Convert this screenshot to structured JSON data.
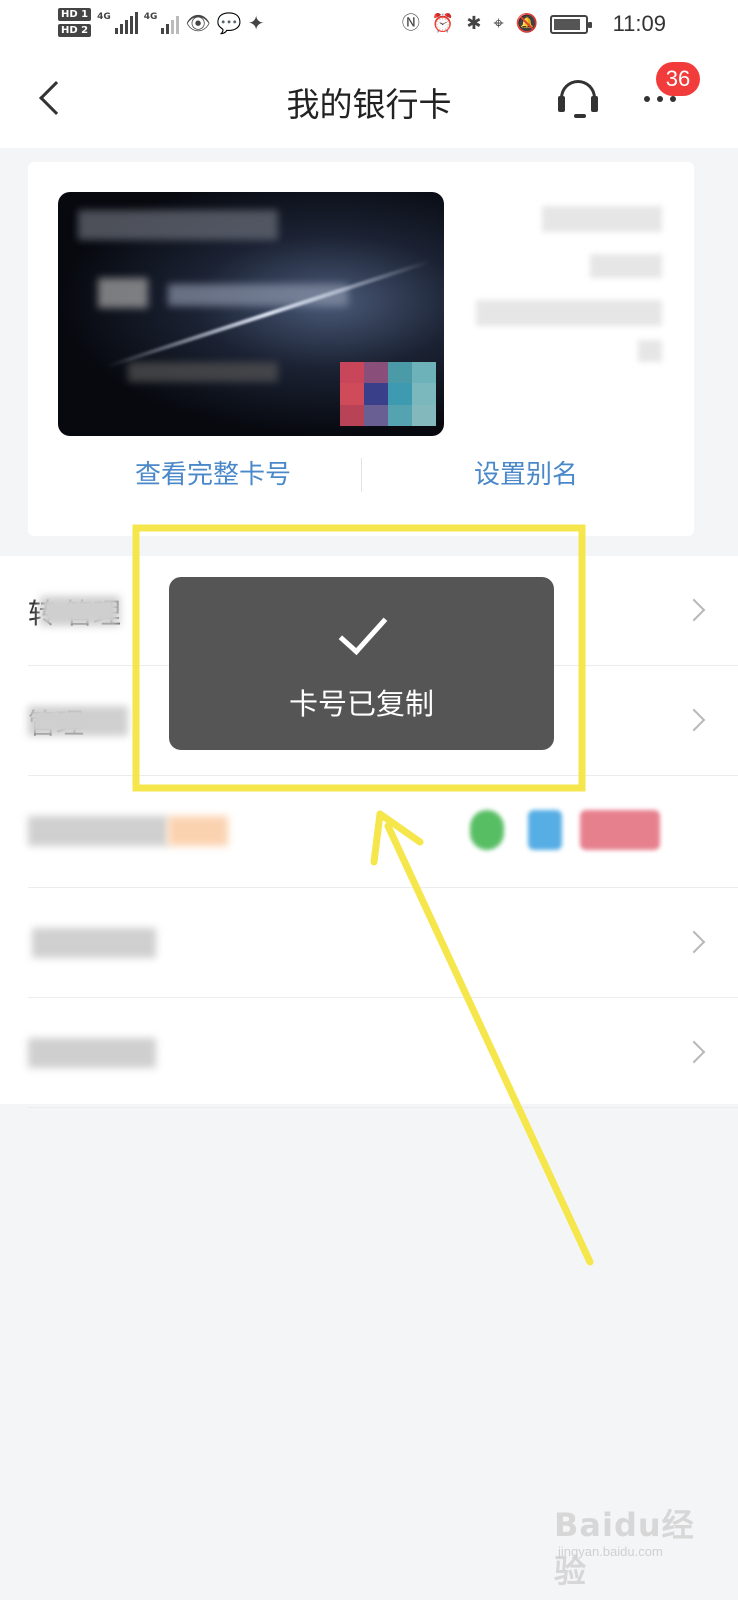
{
  "status_bar": {
    "hd1": "HD 1",
    "hd2": "HD 2",
    "net1": "4G",
    "net2": "4G",
    "time": "11:09"
  },
  "nav": {
    "title": "我的银行卡",
    "badge_count": "36"
  },
  "card_panel": {
    "view_full_number_label": "查看完整卡号",
    "set_alias_label": "设置别名"
  },
  "menu": {
    "items": [
      {
        "label": "转   管理"
      },
      {
        "label": "    管理"
      },
      {
        "label": ""
      },
      {
        "label": ""
      },
      {
        "label": ""
      }
    ]
  },
  "toast": {
    "message": "卡号已复制"
  },
  "watermark": {
    "main": "Baidu经验",
    "sub": "jingyan.baidu.com"
  },
  "colors": {
    "accent_link": "#4a88c9",
    "badge": "#f23b3b",
    "toast_bg": "#555555",
    "highlight": "#f5e64c"
  }
}
